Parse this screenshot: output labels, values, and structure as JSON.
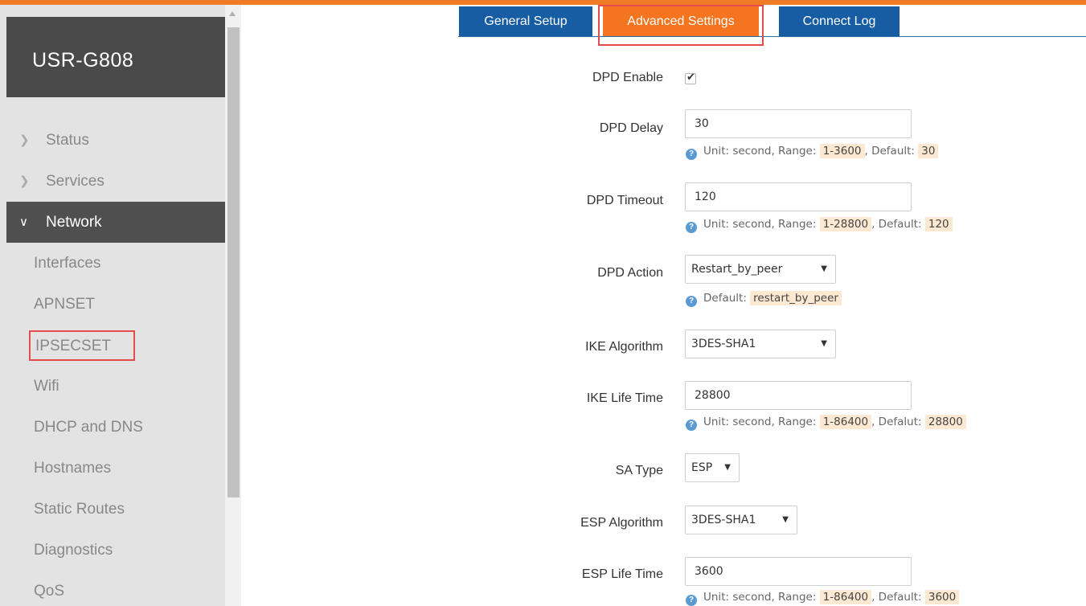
{
  "sidebar": {
    "brand": "USR-G808",
    "menu": [
      {
        "label": "Status",
        "chevron": "chevron-right-icon"
      },
      {
        "label": "Services",
        "chevron": "chevron-right-icon"
      },
      {
        "label": "Network",
        "chevron": "chevron-down-icon",
        "active": true
      }
    ],
    "submenu": [
      "Interfaces",
      "APNSET",
      "IPSECSET",
      "Wifi",
      "DHCP and DNS",
      "Hostnames",
      "Static Routes",
      "Diagnostics",
      "QoS"
    ],
    "selected_submenu": "IPSECSET"
  },
  "tabs": [
    {
      "label": "General Setup"
    },
    {
      "label": "Advanced Settings",
      "active": true
    },
    {
      "label": "Connect Log"
    }
  ],
  "form": {
    "dpd_enable": {
      "label": "DPD Enable",
      "checked": true
    },
    "dpd_delay": {
      "label": "DPD Delay",
      "value": "30",
      "hint_unit": "Unit: second, Range:",
      "hint_range": "1-3600",
      "hint_default_label": ", Default:",
      "hint_default": "30"
    },
    "dpd_timeout": {
      "label": "DPD Timeout",
      "value": "120",
      "hint_unit": "Unit: second, Range:",
      "hint_range": "1-28800",
      "hint_default_label": ", Default:",
      "hint_default": "120"
    },
    "dpd_action": {
      "label": "DPD Action",
      "value": "Restart_by_peer",
      "hint_default_label": "Default:",
      "hint_default": "restart_by_peer"
    },
    "ike_algorithm": {
      "label": "IKE Algorithm",
      "value": "3DES-SHA1"
    },
    "ike_life_time": {
      "label": "IKE Life Time",
      "value": "28800",
      "hint_unit": "Unit: second, Range:",
      "hint_range": "1-86400",
      "hint_default_label": ", Defalut:",
      "hint_default": "28800"
    },
    "sa_type": {
      "label": "SA Type",
      "value": "ESP"
    },
    "esp_algorithm": {
      "label": "ESP Algorithm",
      "value": "3DES-SHA1"
    },
    "esp_life_time": {
      "label": "ESP Life Time",
      "value": "3600",
      "hint_unit": "Unit: second, Range:",
      "hint_range": "1-86400",
      "hint_default_label": ", Default:",
      "hint_default": "3600"
    }
  },
  "colors": {
    "accent_orange": "#f5741f",
    "tab_blue": "#175da3",
    "highlight_outline": "#e34c4c",
    "sidebar_dark": "#4a4a4a",
    "sidebar_bg": "#e3e3e3"
  }
}
